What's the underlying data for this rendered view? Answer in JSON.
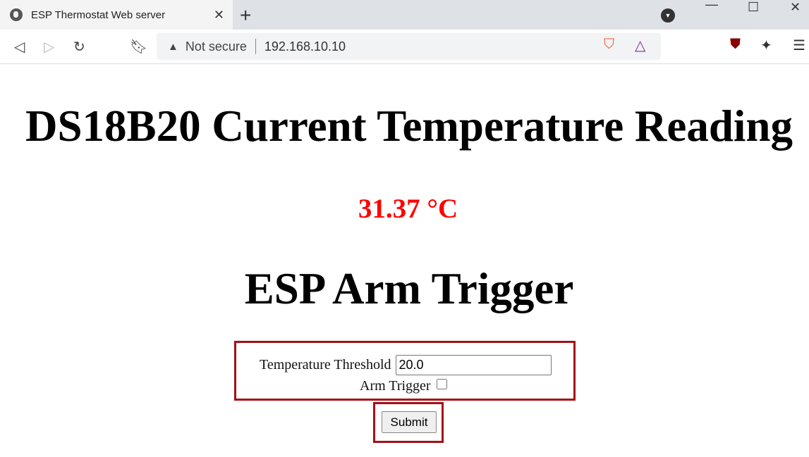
{
  "browser": {
    "tab_title": "ESP Thermostat Web server",
    "security": "Not secure",
    "url": "192.168.10.10"
  },
  "page": {
    "heading": "DS18B20 Current Temperature Reading",
    "temperature": "31.37 °C",
    "trigger_heading": "ESP Arm Trigger",
    "threshold_label": "Temperature Threshold",
    "threshold_value": "20.0",
    "arm_label": "Arm Trigger",
    "arm_checked": false,
    "submit_label": "Submit"
  },
  "colors": {
    "temperature": "#ff0000",
    "highlight_box": "#a50f15"
  }
}
